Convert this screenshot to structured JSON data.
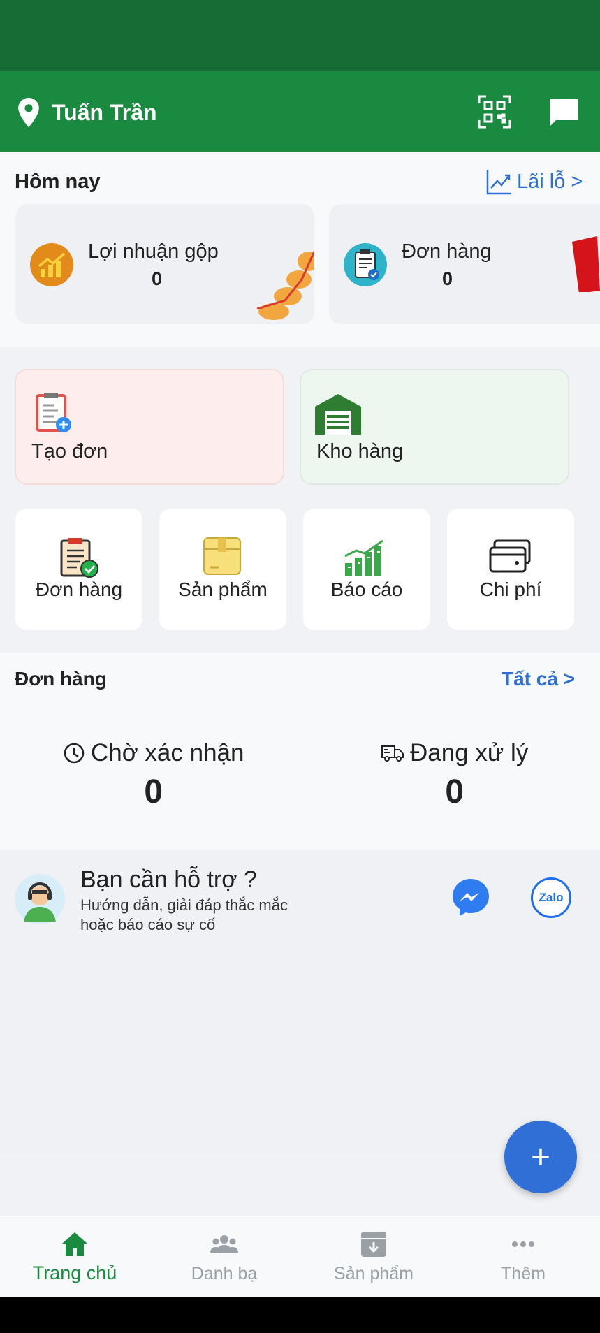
{
  "header": {
    "user_name": "Tuấn Trần"
  },
  "today": {
    "label": "Hôm nay",
    "profit_link": "Lãi lỗ >",
    "cards": [
      {
        "title": "Lợi nhuận gộp",
        "value": "0"
      },
      {
        "title": "Đơn hàng",
        "value": "0"
      }
    ]
  },
  "quick_actions": {
    "create_order": "Tạo đơn",
    "warehouse": "Kho hàng"
  },
  "shortcuts": [
    "Đơn hàng",
    "Sản phẩm",
    "Báo cáo",
    "Chi phí"
  ],
  "orders": {
    "label": "Đơn hàng",
    "all_link": "Tất cả >",
    "pending": {
      "label": "Chờ xác nhận",
      "value": "0"
    },
    "processing": {
      "label": "Đang xử lý",
      "value": "0"
    }
  },
  "support": {
    "title": "Bạn cần hỗ trợ ?",
    "desc_line1": "Hướng dẫn, giải đáp thắc mắc",
    "desc_line2": "hoặc báo cáo sự cố",
    "zalo_label": "Zalo"
  },
  "fab": {
    "label": "+"
  },
  "nav": [
    "Trang chủ",
    "Danh bạ",
    "Sản phẩm",
    "Thêm"
  ],
  "colors": {
    "primary": "#1b8a41",
    "status": "#176b34",
    "accent": "#2f6fd6"
  },
  "icons": [
    "location-icon",
    "qr-scan-icon",
    "chat-icon",
    "trend-icon",
    "home-icon",
    "contacts-icon",
    "product-box-icon",
    "more-icon",
    "messenger-icon",
    "zalo-icon"
  ]
}
